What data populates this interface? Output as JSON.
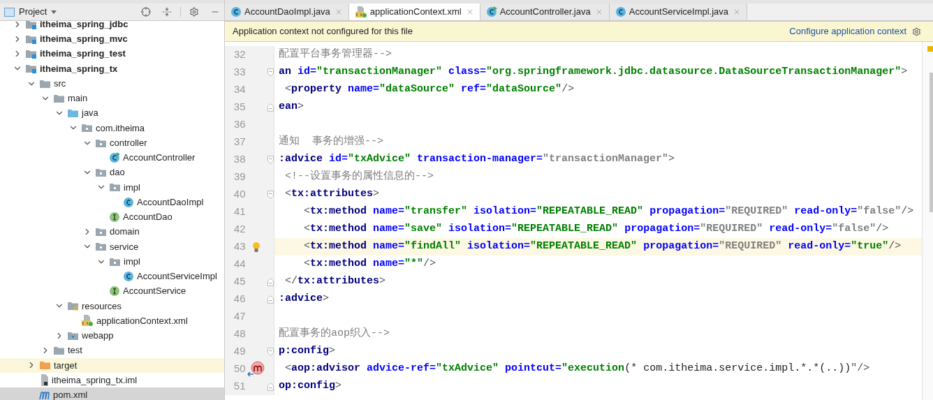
{
  "project_panel": {
    "title": "Project",
    "tree": [
      {
        "label": "itheima_spring_jdbc",
        "kind": "module",
        "expanded": false,
        "selected": false
      },
      {
        "label": "itheima_spring_mvc",
        "kind": "module",
        "expanded": false,
        "selected": false
      },
      {
        "label": "itheima_spring_test",
        "kind": "module",
        "expanded": false,
        "selected": false
      },
      {
        "label": "itheima_spring_tx",
        "kind": "module",
        "expanded": true,
        "selected": false,
        "children": [
          {
            "label": "src",
            "kind": "folder",
            "expanded": true,
            "selected": false,
            "children": [
              {
                "label": "main",
                "kind": "folder",
                "expanded": true,
                "selected": false,
                "children": [
                  {
                    "label": "java",
                    "kind": "source",
                    "expanded": true,
                    "selected": false,
                    "children": [
                      {
                        "label": "com.itheima",
                        "kind": "package",
                        "expanded": true,
                        "selected": false,
                        "children": [
                          {
                            "label": "controller",
                            "kind": "package",
                            "expanded": true,
                            "selected": false,
                            "children": [
                              {
                                "label": "AccountController",
                                "kind": "controller",
                                "selected": false
                              }
                            ]
                          },
                          {
                            "label": "dao",
                            "kind": "package",
                            "expanded": true,
                            "selected": false,
                            "children": [
                              {
                                "label": "impl",
                                "kind": "package",
                                "expanded": true,
                                "selected": false,
                                "children": [
                                  {
                                    "label": "AccountDaoImpl",
                                    "kind": "class",
                                    "selected": false
                                  }
                                ]
                              },
                              {
                                "label": "AccountDao",
                                "kind": "interface",
                                "selected": false
                              }
                            ]
                          },
                          {
                            "label": "domain",
                            "kind": "package",
                            "expanded": false,
                            "selected": false
                          },
                          {
                            "label": "service",
                            "kind": "package",
                            "expanded": true,
                            "selected": false,
                            "children": [
                              {
                                "label": "impl",
                                "kind": "package",
                                "expanded": true,
                                "selected": false,
                                "children": [
                                  {
                                    "label": "AccountServiceImpl",
                                    "kind": "class",
                                    "selected": false
                                  }
                                ]
                              },
                              {
                                "label": "AccountService",
                                "kind": "interface",
                                "selected": false
                              }
                            ]
                          }
                        ]
                      }
                    ]
                  },
                  {
                    "label": "resources",
                    "kind": "resources",
                    "expanded": true,
                    "selected": false,
                    "children": [
                      {
                        "label": "applicationContext.xml",
                        "kind": "xml",
                        "selected": false
                      }
                    ]
                  },
                  {
                    "label": "webapp",
                    "kind": "web",
                    "expanded": false,
                    "selected": false
                  }
                ]
              },
              {
                "label": "test",
                "kind": "folder",
                "expanded": false,
                "selected": false
              }
            ]
          },
          {
            "label": "target",
            "kind": "excluded",
            "expanded": false,
            "selected": false
          },
          {
            "label": "itheima_spring_tx.iml",
            "kind": "iml",
            "selected": false
          },
          {
            "label": "pom.xml",
            "kind": "pom",
            "selected": true
          }
        ]
      }
    ]
  },
  "editor_tabs": [
    {
      "label": "AccountDaoImpl.java",
      "kind": "class",
      "selected": false
    },
    {
      "label": "applicationContext.xml",
      "kind": "xml",
      "selected": true
    },
    {
      "label": "AccountController.java",
      "kind": "controller",
      "selected": false
    },
    {
      "label": "AccountServiceImpl.java",
      "kind": "class",
      "selected": false
    }
  ],
  "banner": {
    "message": "Application context not configured for this file",
    "link": "Configure application context"
  },
  "code_lines": [
    {
      "number": "32",
      "tokens": [
        {
          "kind": "comment",
          "text": "配置平台事务管理器-->"
        }
      ]
    },
    {
      "number": "33",
      "fold_open": true,
      "tokens": [
        {
          "kind": "tag",
          "text": "an"
        },
        {
          "kind": "attr",
          "text": " id="
        },
        {
          "kind": "value",
          "text": "\"transactionManager\""
        },
        {
          "kind": "attr",
          "text": " class="
        },
        {
          "kind": "value",
          "text": "\"org.springframework.jdbc.datasource.DataSourceTransactionManager\""
        },
        {
          "kind": "punct",
          "text": ">"
        }
      ]
    },
    {
      "number": "34",
      "tokens": [
        {
          "kind": "punct",
          "text": " <"
        },
        {
          "kind": "tag",
          "text": "property"
        },
        {
          "kind": "attr",
          "text": " name="
        },
        {
          "kind": "value",
          "text": "\"dataSource\""
        },
        {
          "kind": "attr",
          "text": " ref="
        },
        {
          "kind": "value",
          "text": "\"dataSource\""
        },
        {
          "kind": "punct",
          "text": "/>"
        }
      ]
    },
    {
      "number": "35",
      "fold_close": true,
      "tokens": [
        {
          "kind": "tag",
          "text": "ean"
        },
        {
          "kind": "punct",
          "text": ">"
        }
      ]
    },
    {
      "number": "36"
    },
    {
      "number": "37",
      "tokens": [
        {
          "kind": "comment",
          "text": "通知  事务的增强-->"
        }
      ]
    },
    {
      "number": "38",
      "fold_open": true,
      "tokens": [
        {
          "kind": "tag",
          "text": ":advice"
        },
        {
          "kind": "attr",
          "text": " id="
        },
        {
          "kind": "value",
          "text": "\"txAdvice\""
        },
        {
          "kind": "attr",
          "text": " transaction-manager="
        },
        {
          "kind": "unresolved",
          "text": "\"transactionManager\""
        },
        {
          "kind": "punct",
          "text": ">"
        }
      ]
    },
    {
      "number": "39",
      "tokens": [
        {
          "kind": "comment",
          "text": " <!--设置事务的属性信息的-->"
        }
      ]
    },
    {
      "number": "40",
      "fold_open": true,
      "tokens": [
        {
          "kind": "punct",
          "text": " <"
        },
        {
          "kind": "tag",
          "text": "tx:attributes"
        },
        {
          "kind": "punct",
          "text": ">"
        }
      ]
    },
    {
      "number": "41",
      "tokens": [
        {
          "kind": "punct",
          "text": "    <"
        },
        {
          "kind": "tag",
          "text": "tx:method"
        },
        {
          "kind": "attr",
          "text": " name="
        },
        {
          "kind": "value",
          "text": "\"transfer\""
        },
        {
          "kind": "attr",
          "text": " isolation="
        },
        {
          "kind": "value",
          "text": "\"REPEATABLE_READ\""
        },
        {
          "kind": "attr",
          "text": " propagation="
        },
        {
          "kind": "unresolved",
          "text": "\"REQUIRED\""
        },
        {
          "kind": "attr",
          "text": " read-only="
        },
        {
          "kind": "unresolved",
          "text": "\"false\""
        },
        {
          "kind": "punct",
          "text": "/>"
        }
      ]
    },
    {
      "number": "42",
      "tokens": [
        {
          "kind": "punct",
          "text": "    <"
        },
        {
          "kind": "tag",
          "text": "tx:method"
        },
        {
          "kind": "attr",
          "text": " name="
        },
        {
          "kind": "value",
          "text": "\"save\""
        },
        {
          "kind": "attr",
          "text": " isolation="
        },
        {
          "kind": "value",
          "text": "\"REPEATABLE_READ\""
        },
        {
          "kind": "attr",
          "text": " propagation="
        },
        {
          "kind": "unresolved",
          "text": "\"REQUIRED\""
        },
        {
          "kind": "attr",
          "text": " read-only="
        },
        {
          "kind": "unresolved",
          "text": "\"false\""
        },
        {
          "kind": "punct",
          "text": "/>"
        }
      ]
    },
    {
      "number": "43",
      "current": true,
      "lightbulb": true,
      "tokens": [
        {
          "kind": "punct",
          "text": "    <"
        },
        {
          "kind": "tag",
          "text": "tx:method"
        },
        {
          "kind": "attr",
          "text": " name="
        },
        {
          "kind": "value",
          "text": "\"findAll\""
        },
        {
          "kind": "attr",
          "text": " isolation="
        },
        {
          "kind": "value",
          "text": "\"REPEATABLE_READ\""
        },
        {
          "kind": "attr",
          "text": " propagation="
        },
        {
          "kind": "unresolved",
          "text": "\"REQUIRED\""
        },
        {
          "kind": "attr",
          "text": " read-only="
        },
        {
          "kind": "value",
          "text": "\"true\""
        },
        {
          "kind": "punct",
          "text": "/>"
        }
      ]
    },
    {
      "number": "44",
      "tokens": [
        {
          "kind": "punct",
          "text": "    <"
        },
        {
          "kind": "tag",
          "text": "tx:method"
        },
        {
          "kind": "attr",
          "text": " name="
        },
        {
          "kind": "value",
          "text": "\"*\""
        },
        {
          "kind": "punct",
          "text": "/>"
        }
      ]
    },
    {
      "number": "45",
      "fold_close": true,
      "tokens": [
        {
          "kind": "punct",
          "text": " </"
        },
        {
          "kind": "tag",
          "text": "tx:attributes"
        },
        {
          "kind": "punct",
          "text": ">"
        }
      ]
    },
    {
      "number": "46",
      "fold_close": true,
      "tokens": [
        {
          "kind": "tag",
          "text": ":advice"
        },
        {
          "kind": "punct",
          "text": ">"
        }
      ]
    },
    {
      "number": "47"
    },
    {
      "number": "48",
      "tokens": [
        {
          "kind": "comment",
          "text": "配置事务的aop织入-->"
        }
      ]
    },
    {
      "number": "49",
      "fold_open": true,
      "tokens": [
        {
          "kind": "tag",
          "text": "p:config"
        },
        {
          "kind": "punct",
          "text": ">"
        }
      ]
    },
    {
      "number": "50",
      "spring_marker": true,
      "tokens": [
        {
          "kind": "punct",
          "text": " <"
        },
        {
          "kind": "tag",
          "text": "aop:advisor"
        },
        {
          "kind": "attr",
          "text": " advice-ref="
        },
        {
          "kind": "value",
          "text": "\"txAdvice\""
        },
        {
          "kind": "attr",
          "text": " pointcut="
        },
        {
          "kind": "value",
          "text": "\"execution"
        },
        {
          "kind": "plain",
          "text": "(* com.itheima.service.impl.*.*(..))"
        },
        {
          "kind": "punct",
          "text": "\"/>"
        }
      ]
    },
    {
      "number": "51",
      "fold_close": true,
      "tokens": [
        {
          "kind": "tag",
          "text": "op:config"
        },
        {
          "kind": "punct",
          "text": ">"
        }
      ]
    }
  ]
}
